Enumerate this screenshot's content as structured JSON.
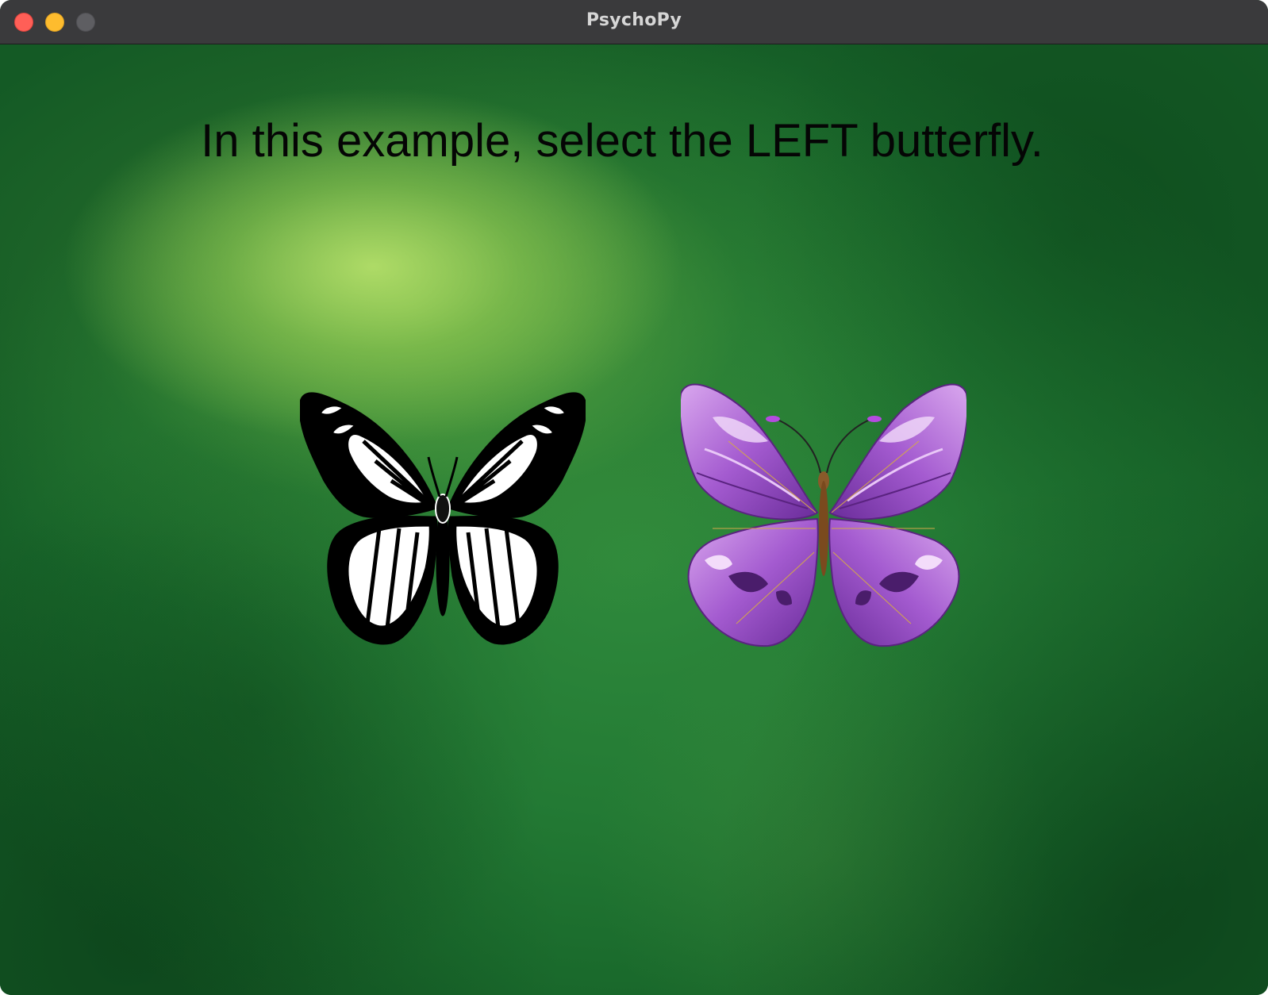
{
  "window": {
    "title": "PsychoPy",
    "controls": {
      "close_color": "#ff5f57",
      "minimize_color": "#febc2e",
      "zoom_color": "#5e5e62"
    }
  },
  "stage": {
    "background_color": "#237a34",
    "instruction": "In this example, select the LEFT butterfly.",
    "stimuli": [
      {
        "name": "monarch-butterfly-bw",
        "colors": [
          "#000000",
          "#ffffff"
        ]
      },
      {
        "name": "purple-butterfly",
        "colors": [
          "#a45bd0",
          "#d9a7ee"
        ]
      }
    ]
  }
}
